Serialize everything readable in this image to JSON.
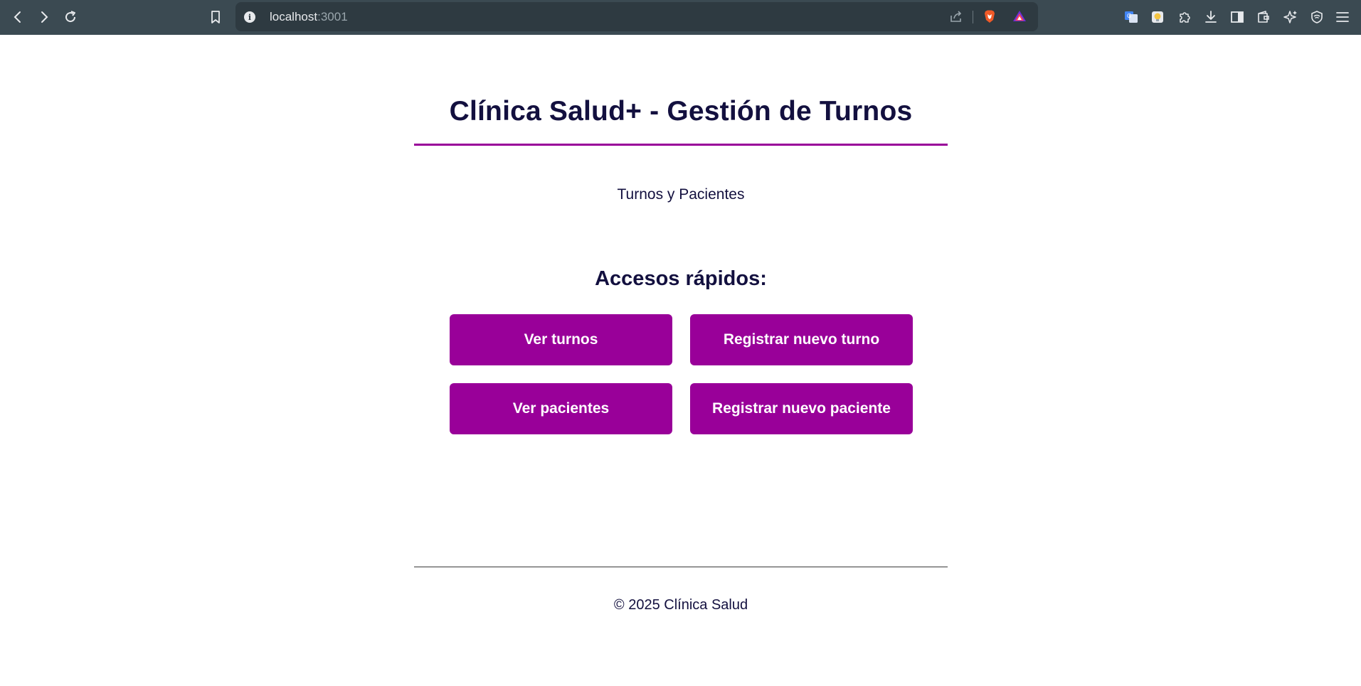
{
  "browser": {
    "url_host": "localhost",
    "url_port": ":3001",
    "icons": [
      "back-icon",
      "forward-icon",
      "reload-icon",
      "bookmark-icon",
      "info-icon",
      "share-icon",
      "brave-shields-icon",
      "brave-rewards-icon",
      "translate-extension-icon",
      "extension-icon",
      "extensions-puzzle-icon",
      "downloads-icon",
      "sidebar-icon",
      "wallet-icon",
      "leo-ai-icon",
      "vpn-icon",
      "menu-icon"
    ]
  },
  "page": {
    "title": "Clínica Salud+ - Gestión de Turnos",
    "subtitle": "Turnos y Pacientes",
    "quick_title": "Accesos rápidos:",
    "buttons": {
      "ver_turnos": "Ver turnos",
      "registrar_turno": "Registrar nuevo turno",
      "ver_pacientes": "Ver pacientes",
      "registrar_paciente": "Registrar nuevo paciente"
    },
    "footer": "© 2025 Clínica Salud"
  },
  "colors": {
    "accent": "#990099",
    "text": "#13103f",
    "toolbar": "#3b4a52"
  }
}
